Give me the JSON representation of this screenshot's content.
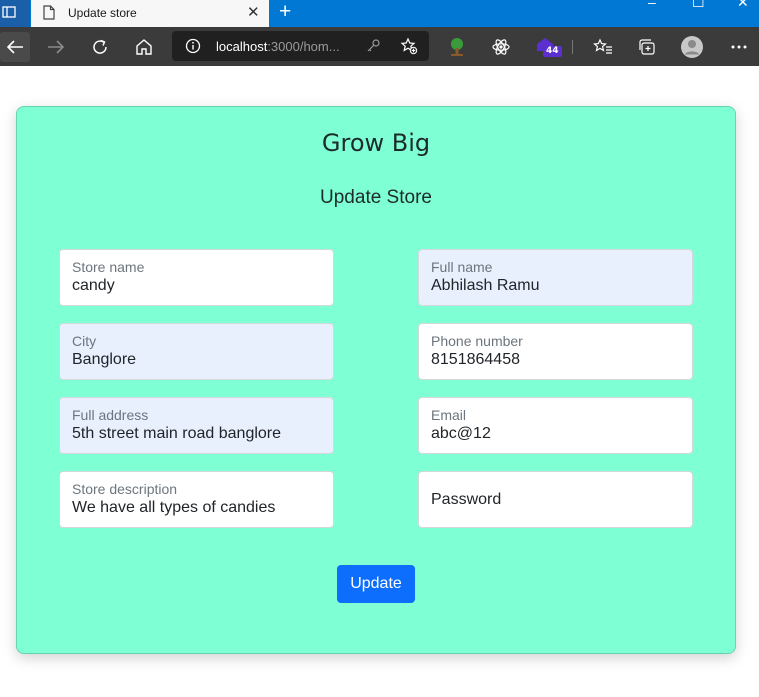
{
  "browser": {
    "tab_title": "Update store",
    "close_glyph": "✕",
    "new_tab_glyph": "+",
    "url_host": "localhost",
    "url_rest": ":3000/hom...",
    "extension_badge": "44",
    "window_controls": [
      "–",
      "☐",
      "✕"
    ],
    "toolbar_icons": [
      "back-arrow-icon",
      "forward-arrow-icon",
      "refresh-icon",
      "home-icon",
      "info-icon",
      "key-icon",
      "add-favorite-icon",
      "tree-extension-icon",
      "react-extension-icon",
      "badge-extension-icon",
      "favorites-icon",
      "collections-icon",
      "profile-icon",
      "more-icon"
    ]
  },
  "page": {
    "brand": "Grow Big",
    "subtitle": "Update Store",
    "fields": {
      "store_name": {
        "label": "Store name",
        "value": "candy"
      },
      "full_name": {
        "label": "Full name",
        "value": "Abhilash Ramu"
      },
      "city": {
        "label": "City",
        "value": "Banglore"
      },
      "phone": {
        "label": "Phone number",
        "value": "8151864458"
      },
      "address": {
        "label": "Full address",
        "value": "5th street main road banglore"
      },
      "email": {
        "label": "Email",
        "value": "abc@12"
      },
      "description": {
        "label": "Store description",
        "value": "We have all types of candies"
      },
      "password": {
        "placeholder": "Password"
      }
    },
    "update_label": "Update"
  },
  "colors": {
    "card_background": "#7fffd4",
    "button": "#0d6efd",
    "autofill": "#e8f0fe",
    "titlebar": "#0078d4",
    "toolbar": "#3b3b3b"
  }
}
